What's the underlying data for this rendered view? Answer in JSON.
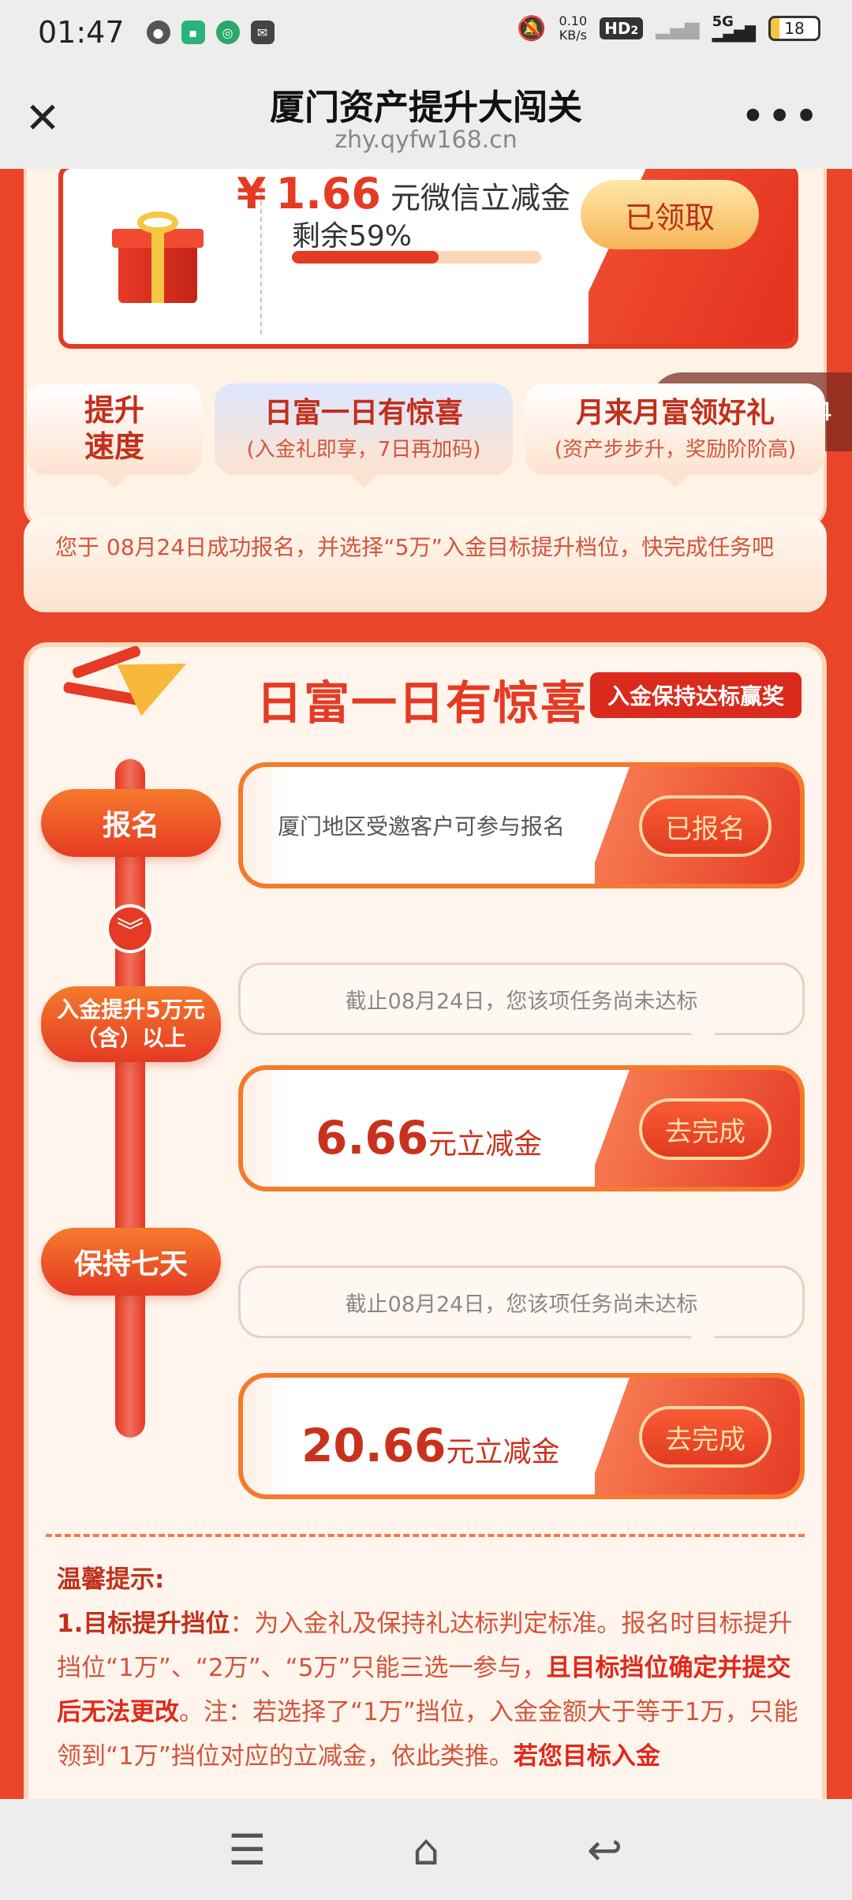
{
  "status": {
    "time": "01:47",
    "net_speed": "0.10\nKB/s",
    "net_speed_top": "0.10",
    "net_speed_bottom": "KB/s",
    "hd": "HD",
    "hd_sub": "2",
    "signal": "5G",
    "battery": "18"
  },
  "nav": {
    "title": "厦门资产提升大闯关",
    "url": "zhy.qyfw168.cn"
  },
  "prize": {
    "currency": "¥",
    "amount": "1.66",
    "amount_suffix": "元微信立减金",
    "remain": "剩余59%",
    "remain_fraction": 0.59,
    "button": "已领取",
    "phone_toast": "133****0724"
  },
  "tabs": [
    {
      "line1": "提升",
      "line2": "速度"
    },
    {
      "title": "日富一日有惊喜",
      "subtitle": "(入金礼即享，7日再加码)"
    },
    {
      "title": "月来月富领好礼",
      "subtitle": "(资产步步升，奖励阶阶高)"
    }
  ],
  "notice": "您于 08月24日成功报名，并选择“5万”入金目标提升档位，快完成任务吧",
  "main": {
    "title": "日富一日有惊喜",
    "badge": "入金保持达标赢奖",
    "steps": [
      {
        "label": "报名"
      },
      {
        "label": "入金提升5万元（含）以上"
      },
      {
        "label": "保持七天"
      }
    ],
    "tasks": [
      {
        "desc": "厦门地区受邀客户可参与报名",
        "button": "已报名"
      },
      {
        "bubble": "截止08月24日，您该项任务尚未达标",
        "amount": "6.66",
        "suffix": "元立减金",
        "button": "去完成"
      },
      {
        "bubble": "截止08月24日，您该项任务尚未达标",
        "amount": "20.66",
        "suffix": "元立减金",
        "button": "去完成"
      }
    ]
  },
  "tips": {
    "heading": "温馨提示:",
    "p1_title": "1.目标提升挡位",
    "p1_a": "：为入金礼及保持礼达标判定标准。报名时目标提升挡位“1万”、“2万”、“5万”只能三选一参与，",
    "p1_b": "且目标挡位确定并提交后无法更改",
    "p1_c": "。注：若选择了“1万”挡位，入金金额大于等于1万，只能领到“1万”挡位对应的立减金，依此类推。",
    "p1_d": "若您目标入金"
  }
}
